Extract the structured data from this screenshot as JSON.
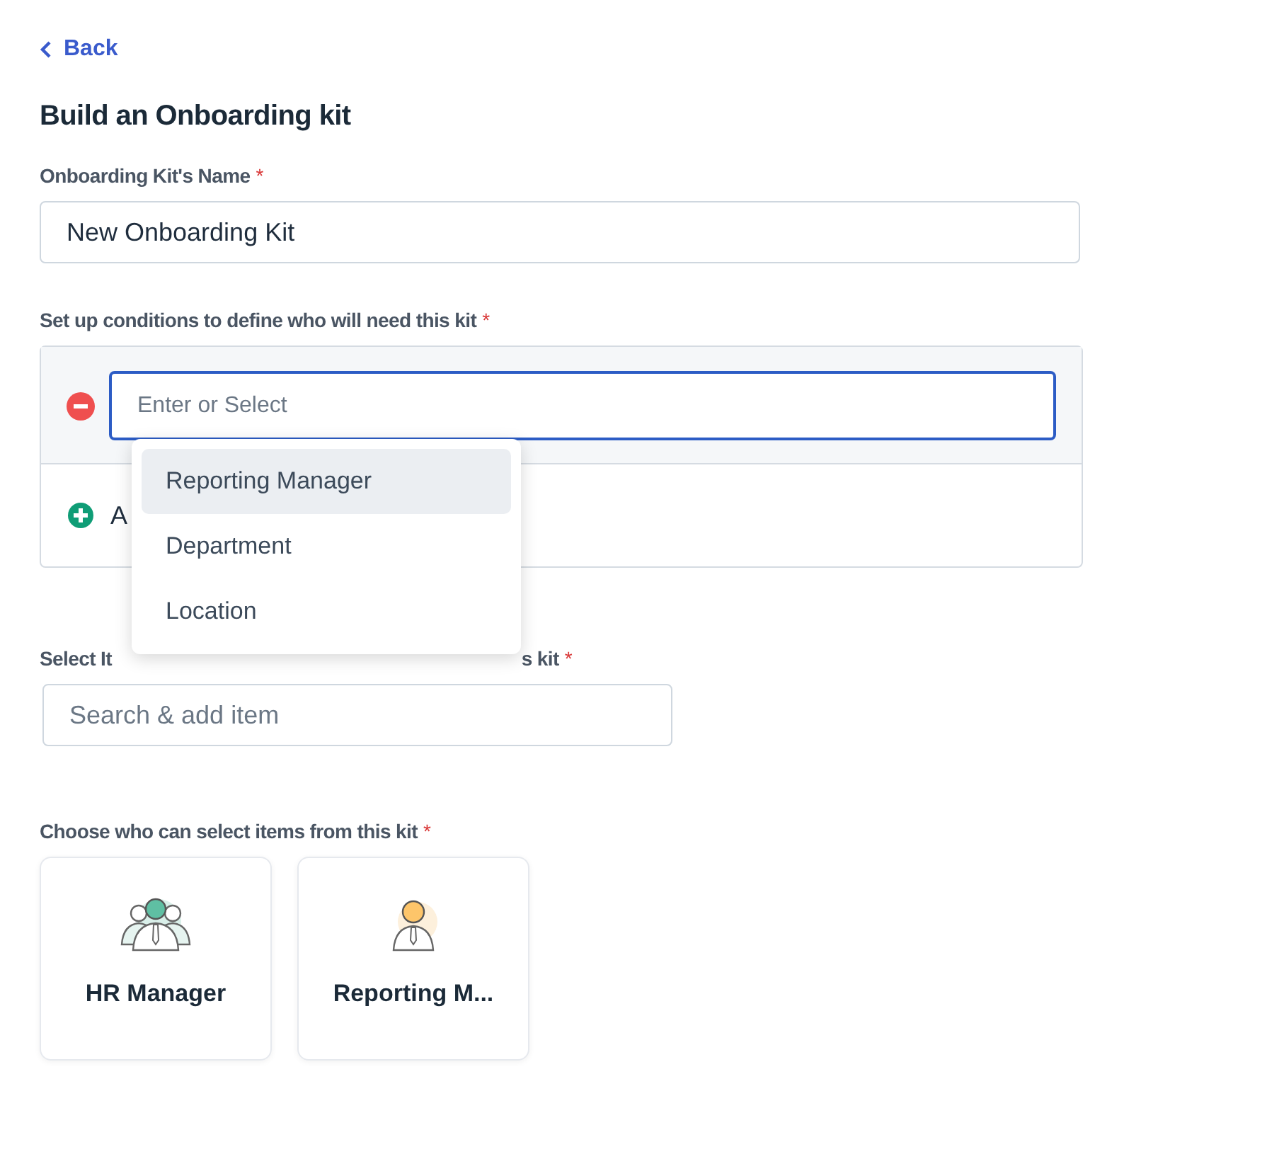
{
  "back": {
    "label": "Back"
  },
  "title": "Build an Onboarding kit",
  "name_field": {
    "label": "Onboarding Kit's Name",
    "mark": "*",
    "value": "New Onboarding Kit"
  },
  "conditions": {
    "label": "Set up conditions to define who will need this kit",
    "mark": "*",
    "field": {
      "placeholder": "Enter or Select",
      "focused": true
    },
    "add_label": "A",
    "dropdown": [
      {
        "label": "Reporting Manager",
        "selected": true
      },
      {
        "label": "Department",
        "selected": false
      },
      {
        "label": "Location",
        "selected": false
      }
    ]
  },
  "items": {
    "label_start": "Select It",
    "label_end": "s kit",
    "mark": "*",
    "search": {
      "placeholder": "Search & add item"
    }
  },
  "selectors": {
    "label": "Choose who can select items from this kit",
    "mark": "*",
    "cards": [
      {
        "label": "HR Manager",
        "kind": "group"
      },
      {
        "label": "Reporting M...",
        "kind": "single"
      }
    ]
  }
}
